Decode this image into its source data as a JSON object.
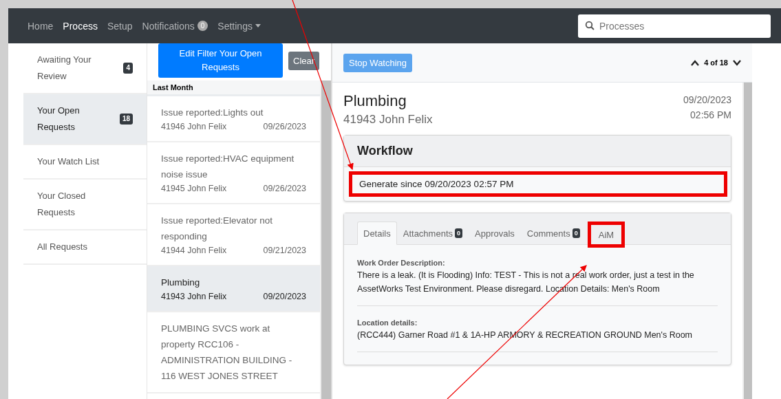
{
  "nav": {
    "items": [
      {
        "label": "Home",
        "selected": false
      },
      {
        "label": "Process",
        "selected": true
      },
      {
        "label": "Setup",
        "selected": false
      },
      {
        "label": "Notifications",
        "selected": false,
        "badge": "0"
      },
      {
        "label": "Settings",
        "selected": false,
        "dropdown": true
      }
    ],
    "search": {
      "placeholder": "Processes"
    }
  },
  "sidebar": {
    "items": [
      {
        "label": "Awaiting Your Review",
        "badge": "4",
        "selected": false
      },
      {
        "label": "Your Open Requests",
        "badge": "18",
        "selected": true
      },
      {
        "label": "Your Watch List",
        "selected": false
      },
      {
        "label": "Your Closed Requests",
        "selected": false
      },
      {
        "label": "All Requests",
        "selected": false
      }
    ]
  },
  "list": {
    "filter_button": "Edit Filter Your Open Requests",
    "clear_button": "Clear",
    "group": "Last Month",
    "items": [
      {
        "title": "Issue reported:Lights out",
        "meta": "41946 John Felix",
        "date": "09/26/2023",
        "selected": false
      },
      {
        "title": "Issue reported:HVAC equipment noise issue",
        "meta": "41945 John Felix",
        "date": "09/26/2023",
        "selected": false
      },
      {
        "title": "Issue reported:Elevator not responding",
        "meta": "41944 John Felix",
        "date": "09/21/2023",
        "selected": false
      },
      {
        "title": "Plumbing",
        "meta": "41943 John Felix",
        "date": "09/20/2023",
        "selected": true
      },
      {
        "title": "PLUMBING SVCS work at property RCC106 - ADMINISTRATION BUILDING - 116 WEST JONES STREET",
        "selected": false
      }
    ]
  },
  "detail": {
    "watch_button": "Stop Watching",
    "pager": "4 of 18",
    "title": "Plumbing",
    "subtitle": "41943 John Felix",
    "date": "09/20/2023",
    "time": "02:56 PM",
    "workflow": {
      "title": "Workflow",
      "text": "Generate since 09/20/2023 02:57 PM"
    },
    "tabs": [
      {
        "label": "Details",
        "selected": true
      },
      {
        "label": "Attachments",
        "badge": "0",
        "selected": false
      },
      {
        "label": "Approvals",
        "selected": false
      },
      {
        "label": "Comments",
        "badge": "0",
        "selected": false
      },
      {
        "label": "AiM",
        "selected": false
      }
    ],
    "fields": [
      {
        "label": "Work Order Description:",
        "value": "There is a leak. (It is Flooding) Info: TEST - This is not a real work order, just a test in the AssetWorks Test Environment. Please disregard. Location Details: Men's Room"
      },
      {
        "label": "Location details:",
        "value": "(RCC444) Garner Road #1 & 1A-HP ARMORY & RECREATION GROUND Men's Room"
      }
    ]
  }
}
